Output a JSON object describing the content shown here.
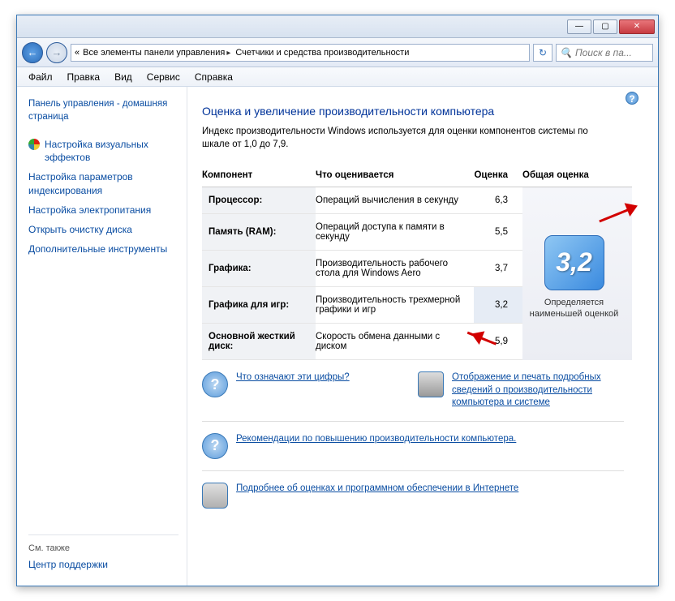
{
  "titlebar": {
    "minimize": "—",
    "maximize": "▢",
    "close": "✕"
  },
  "nav": {
    "back": "←",
    "forward": "→",
    "refresh": "↻",
    "search_placeholder": "Поиск в па...",
    "search_glyph": "🔍"
  },
  "address": {
    "prefix": "«",
    "seg1": "Все элементы панели управления",
    "seg2": "Счетчики и средства производительности"
  },
  "menu": {
    "file": "Файл",
    "edit": "Правка",
    "view": "Вид",
    "service": "Сервис",
    "help": "Справка"
  },
  "sidebar": {
    "home": "Панель управления - домашняя страница",
    "items": [
      "Настройка визуальных эффектов",
      "Настройка параметров индексирования",
      "Настройка электропитания",
      "Открыть очистку диска",
      "Дополнительные инструменты"
    ],
    "also_label": "См. также",
    "support": "Центр поддержки"
  },
  "content": {
    "help_glyph": "?",
    "heading": "Оценка и увеличение производительности компьютера",
    "desc": "Индекс производительности Windows используется для оценки компонентов системы по шкале от 1,0 до 7,9.",
    "th_component": "Компонент",
    "th_eval": "Что оценивается",
    "th_score": "Оценка",
    "th_overall": "Общая оценка",
    "rows": [
      {
        "comp": "Процессор:",
        "eval": "Операций вычисления в секунду",
        "score": "6,3"
      },
      {
        "comp": "Память (RAM):",
        "eval": "Операций доступа к памяти в секунду",
        "score": "5,5"
      },
      {
        "comp": "Графика:",
        "eval": "Производительность рабочего стола для Windows Aero",
        "score": "3,7"
      },
      {
        "comp": "Графика для игр:",
        "eval": "Производительность трехмерной графики и игр",
        "score": "3,2"
      },
      {
        "comp": "Основной жесткий диск:",
        "eval": "Скорость обмена данными с диском",
        "score": "5,9"
      }
    ],
    "overall_score": "3,2",
    "overall_note": "Определяется наименьшей оценкой",
    "link_q_glyph": "?",
    "link_whatdigits": "Что означают эти цифры?",
    "link_printdetails": "Отображение и печать подробных сведений о производительности компьютера и системе",
    "link_recommend": "Рекомендации по повышению производительности компьютера.",
    "link_software": "Подробнее об оценках и программном обеспечении в Интернете"
  }
}
